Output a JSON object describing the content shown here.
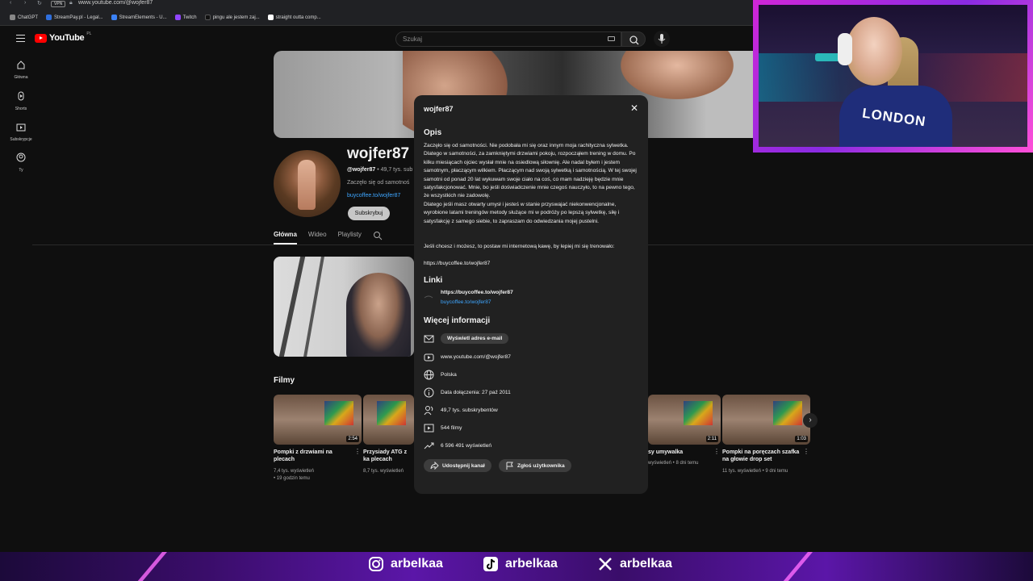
{
  "browser": {
    "url": "www.youtube.com/@wojfer87",
    "vpn": "VPN",
    "bookmarks": [
      {
        "label": "ChatGPT",
        "color": "#888888"
      },
      {
        "label": "StreamPay.pl - Legal...",
        "color": "#2f6fdd"
      },
      {
        "label": "StreamElements - U...",
        "color": "#3b82f6"
      },
      {
        "label": "Twitch",
        "color": "#9146ff"
      },
      {
        "label": "pingu ale jestem zaj...",
        "color": "#111111"
      },
      {
        "label": "straight outta comp...",
        "color": "#ffffff"
      }
    ]
  },
  "header": {
    "logo_text": "YouTube",
    "logo_region": "PL",
    "search_placeholder": "Szukaj"
  },
  "sidebar": {
    "items": [
      {
        "label": "Główna",
        "icon": "home-icon"
      },
      {
        "label": "Shorts",
        "icon": "shorts-icon"
      },
      {
        "label": "Subskrypcje",
        "icon": "subscriptions-icon"
      },
      {
        "label": "Ty",
        "icon": "you-icon"
      }
    ]
  },
  "channel": {
    "name": "wojfer87",
    "handle": "@wojfer87",
    "handle_meta": "• 49,7 tys. sub",
    "description_preview": "Zaczęło się od samotnoś",
    "link": "buycoffee.to/wojfer87",
    "subscribe_label": "Subskrybuj",
    "tabs": [
      "Główna",
      "Wideo",
      "Playlisty"
    ],
    "films_heading": "Filmy"
  },
  "videos": [
    {
      "title": "Pompki z drzwiami na plecach",
      "meta1": "7,4 tys. wyświetleń",
      "meta2": "• 19 godzin temu",
      "duration": "2:54"
    },
    {
      "title": "Przysiady ATG z ka plecach",
      "meta1": "8,7 tys. wyświetleń",
      "meta2": "",
      "duration": ""
    },
    {
      "title": "sy umywalka",
      "meta1": "wyświetleń • 8 dni temu",
      "meta2": "",
      "duration": "2:11"
    },
    {
      "title": "Pompki na poręczach szafka na głowie drop set",
      "meta1": "11 tys. wyświetleń • 9 dni temu",
      "meta2": "",
      "duration": "1:03"
    }
  ],
  "modal": {
    "title": "wojfer87",
    "description_heading": "Opis",
    "description": "Zaczęło się od samotności. Nie podobała mi się oraz innym moja rachityczna sylwetka. Dlatego w samotności, za zamkniętymi drzwiami pokoju, rozpocząłem trening w domu. Po kilku miesiącach ojciec wysłał mnie na osiedlową siłownię. Ale nadal byłem i jestem samotnym, płaczącym wilkiem. Płaczącym nad swoją sylwetką i samotnością. W tej swojej samotni od ponad 20 lat wykuwam swoje ciało na coś, co mam nadzieję będzie mnie satysfakcjonować. Mnie, bo jeśli doświadczenie mnie czegoś nauczyło, to na pewno tego, że wszystkich nie zadowolę.\nDlatego jeśli masz otwarty umysł i jesteś w stanie przyswajać niekonwencjonalne, wyrobione latami treningów metody służące mi w podróży po lepszą sylwetkę, siłę i satysfakcję z samego siebie, to zapraszam do odwiedzania mojej pustelni.",
    "coffee_line": "Jeśli chcesz i możesz, to postaw mi internetową kawę, by lepiej mi się trenowało:",
    "coffee_url": "https://buycoffee.to/wojfer87",
    "links_heading": "Linki",
    "link_title": "https://buycoffee.to/wojfer87",
    "link_url": "buycoffee.to/wojfer87",
    "more_heading": "Więcej informacji",
    "email_button": "Wyświetl adres e-mail",
    "channel_url": "www.youtube.com/@wojfer87",
    "country": "Polska",
    "joined": "Data dołączenia: 27 paź 2011",
    "subscribers": "49,7 tys. subskrybentów",
    "videos_count": "544 filmy",
    "views": "6 596 491 wyświetleń",
    "share_button": "Udostępnij kanał",
    "report_button": "Zgłoś użytkownika"
  },
  "overlay": {
    "shirt_text": "LONDON",
    "socials": [
      {
        "handle": "arbelkaa",
        "icon": "instagram-icon"
      },
      {
        "handle": "arbelkaa",
        "icon": "tiktok-icon"
      },
      {
        "handle": "arbelkaa",
        "icon": "x-icon"
      }
    ]
  },
  "colors": {
    "accent_link": "#3ea6ff",
    "youtube_red": "#ff0000",
    "overlay_purple": "#5b16a8",
    "overlay_pink": "#ff4fd8"
  }
}
